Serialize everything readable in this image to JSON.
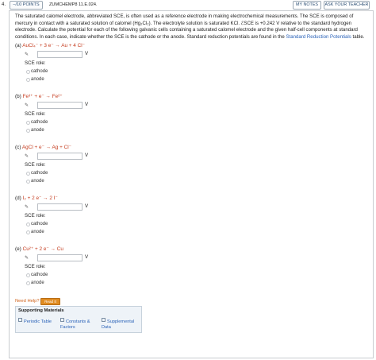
{
  "header": {
    "question_number": "4.",
    "points_label": "–/10 POINTS",
    "problem_code": "ZUMCHEMP8 11.E.024.",
    "my_notes_label": "MY NOTES",
    "ask_teacher_label": "ASK YOUR TEACHER"
  },
  "intro": {
    "text": "The saturated calomel electrode, abbreviated SCE, is often used as a reference electrode in making electrochemical measurements. The SCE is composed of mercury in contact with a saturated solution of calomel (Hg₂Cl₂). The electrolyte solution is saturated KCl. ℰSCE is +0.242 V relative to the standard hydrogen electrode. Calculate the potential for each of the following galvanic cells containing a saturated calomel electrode and the given half-cell components at standard conditions. In each case, indicate whether the SCE is the cathode or the anode. Standard reduction potentials are found in the",
    "link_text": "Standard Reduction Potentials",
    "suffix": "table."
  },
  "parts": [
    {
      "label": "(a)",
      "reaction": "AuCl₄⁻ + 3 e⁻ → Au + 4 Cl⁻",
      "unit": "V",
      "role_label": "SCE role:",
      "options": [
        "cathode",
        "anode"
      ]
    },
    {
      "label": "(b)",
      "reaction": "Fe³⁺ + e⁻ → Fe²⁺",
      "unit": "V",
      "role_label": "SCE role:",
      "options": [
        "cathode",
        "anode"
      ]
    },
    {
      "label": "(c)",
      "reaction": "AgCl + e⁻ → Ag + Cl⁻",
      "unit": "V",
      "role_label": "SCE role:",
      "options": [
        "cathode",
        "anode"
      ]
    },
    {
      "label": "(d)",
      "reaction": "I₂ + 2 e⁻ → 2 I⁻",
      "unit": "V",
      "role_label": "SCE role:",
      "options": [
        "cathode",
        "anode"
      ]
    },
    {
      "label": "(e)",
      "reaction": "Cu²⁺ + 2 e⁻ → Cu",
      "unit": "V",
      "role_label": "SCE role:",
      "options": [
        "cathode",
        "anode"
      ]
    }
  ],
  "help": {
    "need_help": "Need Help?",
    "read_it": "Read It"
  },
  "supporting": {
    "title": "Supporting Materials",
    "items": [
      "Periodic Table",
      "Constants & Factors",
      "Supplemental Data"
    ]
  },
  "colors": {
    "reaction_red": "#c43a1c",
    "link_blue": "#2a62b8",
    "read_it_orange": "#e08c22"
  }
}
